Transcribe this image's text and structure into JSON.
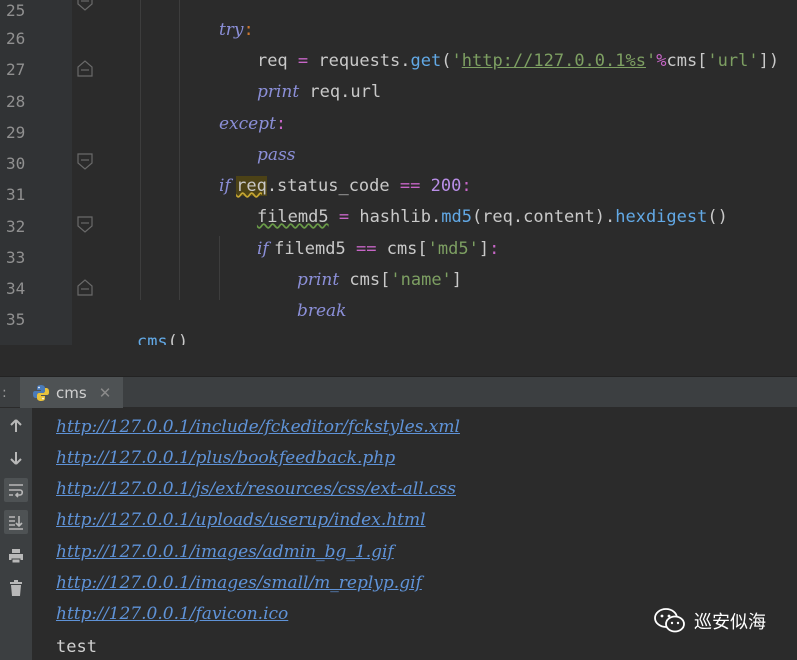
{
  "editor": {
    "lines": [
      {
        "num": "25"
      },
      {
        "num": "26"
      },
      {
        "num": "27"
      },
      {
        "num": "28"
      },
      {
        "num": "29"
      },
      {
        "num": "30"
      },
      {
        "num": "31"
      },
      {
        "num": "32"
      },
      {
        "num": "33"
      },
      {
        "num": "34"
      },
      {
        "num": "35"
      }
    ],
    "code": {
      "l25_try": "try",
      "l25_colon": ":",
      "l26_req": "req ",
      "l26_eq": "=",
      "l26_requests": " requests.",
      "l26_get": "get",
      "l26_open": "(",
      "l26_q1": "'",
      "l26_url": "http://127.0.0.1%s",
      "l26_q2": "'",
      "l26_pct": "%",
      "l26_cms": "cms[",
      "l26_key": "'url'",
      "l26_close": "])",
      "l27_print": "print",
      "l27_rest": " req.url",
      "l28_except": "except",
      "l28_colon": ":",
      "l29_pass": "pass",
      "l30_if": "if ",
      "l30_req": "req",
      "l30_rest": ".status_code ",
      "l30_eqeq": "==",
      "l30_space": " ",
      "l30_num": "200",
      "l30_colon": ":",
      "l31_var": "filemd5",
      "l31_eq": " = ",
      "l31_hashlib": "hashlib.",
      "l31_md5": "md5",
      "l31_arg": "(req.content).",
      "l31_hex": "hexdigest",
      "l31_paren": "()",
      "l32_if": "if ",
      "l32_var": "filemd5 ",
      "l32_eqeq": "==",
      "l32_cms": " cms[",
      "l32_key": "'md5'",
      "l32_close": "]",
      "l32_colon": ":",
      "l33_print": "print",
      "l33_cms": " cms[",
      "l33_key": "'name'",
      "l33_close": "]",
      "l34_break": "break",
      "l35_call": "cms",
      "l35_paren": "()"
    }
  },
  "run_panel": {
    "strip_marker": ":",
    "tab_label": "cms",
    "tab_close": "✕",
    "tab_icon": "python-icon",
    "toolbar_icons": [
      "arrow-up-icon",
      "arrow-down-icon",
      "soft-wrap-icon",
      "scroll-to-end-icon",
      "print-icon",
      "trash-icon"
    ],
    "output": [
      "http://127.0.0.1/include/fckeditor/fckstyles.xml",
      "http://127.0.0.1/plus/bookfeedback.php",
      "http://127.0.0.1/js/ext/resources/css/ext-all.css",
      "http://127.0.0.1/uploads/userup/index.html",
      "http://127.0.0.1/images/admin_bg_1.gif",
      "http://127.0.0.1/images/small/m_replyp.gif",
      "http://127.0.0.1/favicon.ico"
    ],
    "output_last": "test"
  },
  "watermark": {
    "text": "巡安似海",
    "icon": "wechat-icon"
  }
}
